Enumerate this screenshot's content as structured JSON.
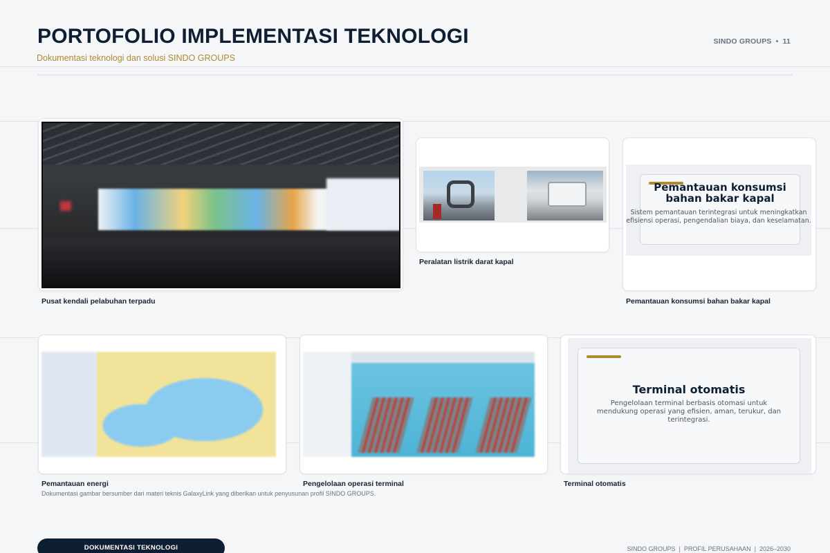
{
  "header": {
    "title": "PORTOFOLIO IMPLEMENTASI TEKNOLOGI",
    "subtitle": "Dokumentasi teknologi dan solusi SINDO GROUPS",
    "brand": "SINDO GROUPS",
    "page_number": "11"
  },
  "gallery": [
    {
      "caption": "Pusat kendali pelabuhan terpadu"
    },
    {
      "caption": "Peralatan listrik darat kapal"
    },
    {
      "caption": "Pemantauan konsumsi bahan bakar kapal",
      "overlay_title": "Pemantauan konsumsi bahan bakar kapal",
      "overlay_desc": "Sistem pemantauan terintegrasi untuk meningkatkan efisiensi operasi, pengendalian biaya, dan keselamatan."
    },
    {
      "caption": "Pemantauan energi"
    },
    {
      "caption": "Pengelolaan operasi terminal"
    },
    {
      "caption": "Terminal otomatis",
      "overlay_title": "Terminal otomatis",
      "overlay_desc": "Pengelolaan terminal berbasis otomasi untuk mendukung operasi yang efisien, aman, terukur, dan terintegrasi."
    }
  ],
  "footnote": "Dokumentasi gambar bersumber dari materi teknis GalaxyLink yang diberikan untuk penyusunan profil SINDO GROUPS.",
  "footer": {
    "button_label": "DOKUMENTASI TEKNOLOGI",
    "brand": "SINDO GROUPS",
    "profile": "PROFIL PERUSAHAAN",
    "period": "2026–2030"
  },
  "colors": {
    "navy": "#0f1f33",
    "gold": "#b08a2e",
    "background": "#f5f6f8"
  }
}
